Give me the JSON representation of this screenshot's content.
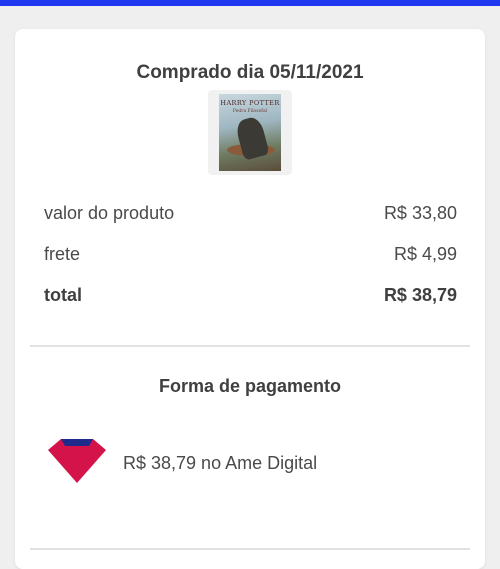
{
  "colors": {
    "top_bar": "#1f38f0",
    "ame_red": "#d4134a",
    "ame_blue": "#1f2b8c"
  },
  "purchase": {
    "title": "Comprado dia 05/11/2021",
    "product_image_icon": "book-cover-icon",
    "book_cover_text": "HARRY POTTER",
    "book_cover_subtitle": "Pedra Filosofal"
  },
  "summary": {
    "rows": [
      {
        "label": "valor do produto",
        "value": "R$ 33,80"
      },
      {
        "label": "frete",
        "value": "R$ 4,99"
      },
      {
        "label": "total",
        "value": "R$ 38,79"
      }
    ]
  },
  "payment": {
    "title": "Forma de pagamento",
    "method_icon": "ame-digital-icon",
    "method_text": "R$ 38,79 no Ame Digital"
  }
}
